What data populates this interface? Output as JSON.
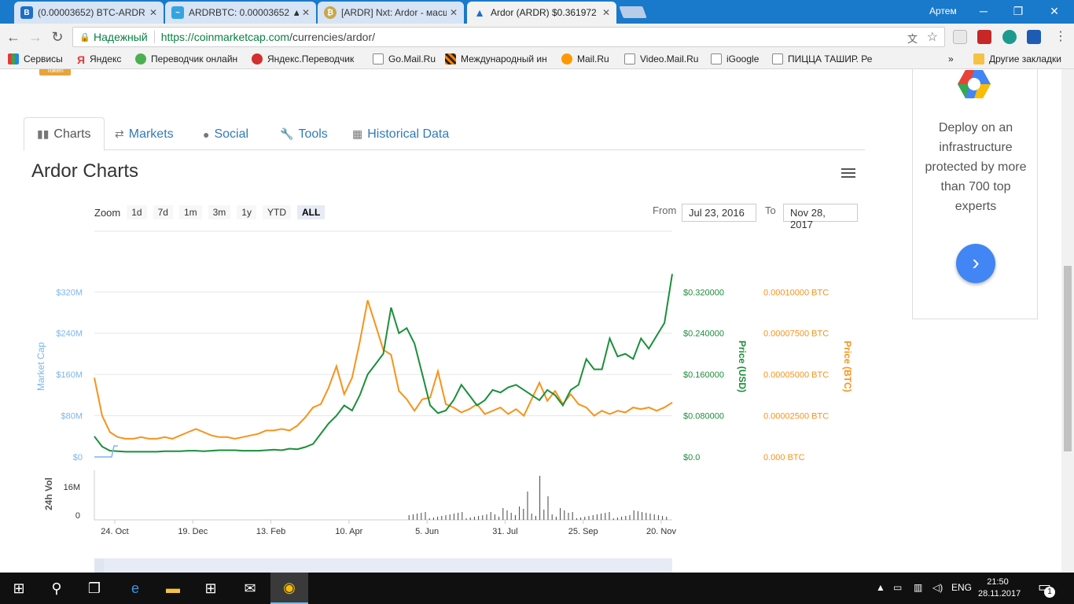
{
  "browser": {
    "tabs": [
      {
        "title": "(0.00003652) BTC-ARDR",
        "icon": "bittrex-icon",
        "color": "#1e6fc4"
      },
      {
        "title": "ARDRBTC: 0.00003652 ▲",
        "icon": "tradingview-icon",
        "color": "#36a3e0"
      },
      {
        "title": "[ARDR] Nxt: Ardor - масш",
        "icon": "bitcointalk-icon",
        "color": "#c9a74a"
      },
      {
        "title": "Ardor (ARDR) $0.361972",
        "icon": "ardor-icon",
        "color": "#1e6fc4"
      }
    ],
    "user": "Артем",
    "secure_label": "Надежный",
    "url_domain": "https://coinmarketcap.com",
    "url_path": "/currencies/ardor/",
    "bookmarks": [
      "Сервисы",
      "Яндекс",
      "Переводчик онлайн",
      "Яндекс.Переводчик",
      "Go.Mail.Ru",
      "Международный ин",
      "Mail.Ru",
      "Video.Mail.Ru",
      "iGoogle",
      "ПИЦЦА ТАШИР. Ре"
    ],
    "bookmarks_more": "»",
    "other_bookmarks": "Другие закладки"
  },
  "page": {
    "token_badge": "Token",
    "tabs": [
      "Charts",
      "Markets",
      "Social",
      "Tools",
      "Historical Data"
    ],
    "chart_title": "Ardor Charts",
    "zoom_label": "Zoom",
    "zoom_options": [
      "1d",
      "7d",
      "1m",
      "3m",
      "1y",
      "YTD",
      "ALL"
    ],
    "from_label": "From",
    "from_date": "Jul 23, 2016",
    "to_label": "To",
    "to_date": "Nov 28, 2017"
  },
  "chart_data": {
    "type": "line",
    "x_ticks": [
      "24. Oct",
      "19. Dec",
      "13. Feb",
      "10. Apr",
      "5. Jun",
      "31. Jul",
      "25. Sep",
      "20. Nov"
    ],
    "market_cap_axis": {
      "label": "Market Cap",
      "ticks": [
        "$0",
        "$80M",
        "$160M",
        "$240M",
        "$320M"
      ],
      "color": "#7cb5ec"
    },
    "usd_axis": {
      "label": "Price (USD)",
      "ticks": [
        "$0.0",
        "$0.080000",
        "$0.160000",
        "$0.240000",
        "$0.320000"
      ],
      "color": "#1a8f3a",
      "ylim": [
        0,
        0.32
      ]
    },
    "btc_axis": {
      "label": "Price (BTC)",
      "ticks": [
        "0.000 BTC",
        "0.00002500 BTC",
        "0.00005000 BTC",
        "0.00007500 BTC",
        "0.00010000 BTC"
      ],
      "color": "#f7931a",
      "ylim": [
        0,
        0.0001
      ]
    },
    "volume_axis": {
      "label": "24h Vol",
      "ticks": [
        "0",
        "16M"
      ]
    },
    "series": [
      {
        "name": "Price (USD)",
        "color": "#1a8f3a",
        "values": [
          0.04,
          0.02,
          0.012,
          0.011,
          0.01,
          0.01,
          0.01,
          0.01,
          0.01,
          0.011,
          0.011,
          0.011,
          0.012,
          0.012,
          0.011,
          0.012,
          0.013,
          0.013,
          0.013,
          0.012,
          0.012,
          0.012,
          0.013,
          0.014,
          0.013,
          0.016,
          0.015,
          0.019,
          0.025,
          0.045,
          0.065,
          0.08,
          0.1,
          0.09,
          0.12,
          0.16,
          0.18,
          0.2,
          0.29,
          0.24,
          0.25,
          0.22,
          0.16,
          0.1,
          0.085,
          0.09,
          0.11,
          0.14,
          0.12,
          0.1,
          0.11,
          0.13,
          0.125,
          0.135,
          0.14,
          0.13,
          0.12,
          0.11,
          0.13,
          0.12,
          0.1,
          0.13,
          0.14,
          0.19,
          0.17,
          0.17,
          0.23,
          0.195,
          0.2,
          0.19,
          0.23,
          0.21,
          0.235,
          0.26,
          0.355
        ]
      },
      {
        "name": "Price (BTC)",
        "color": "#f7931a",
        "values": [
          4.8e-05,
          2.5e-05,
          1.5e-05,
          1.2e-05,
          1.1e-05,
          1.1e-05,
          1.2e-05,
          1.1e-05,
          1.1e-05,
          1.2e-05,
          1.1e-05,
          1.3e-05,
          1.5e-05,
          1.7e-05,
          1.5e-05,
          1.3e-05,
          1.2e-05,
          1.2e-05,
          1.1e-05,
          1.2e-05,
          1.3e-05,
          1.4e-05,
          1.6e-05,
          1.6e-05,
          1.7e-05,
          1.6e-05,
          1.9e-05,
          2.4e-05,
          3e-05,
          3.2e-05,
          4.2e-05,
          5.5e-05,
          3.8e-05,
          4.8e-05,
          7e-05,
          9.5e-05,
          8e-05,
          6.5e-05,
          6.2e-05,
          4e-05,
          3.5e-05,
          2.8e-05,
          3.5e-05,
          3.6e-05,
          5.2e-05,
          3.2e-05,
          3e-05,
          2.7e-05,
          2.9e-05,
          3.2e-05,
          2.6e-05,
          2.8e-05,
          3e-05,
          2.6e-05,
          2.9e-05,
          2.5e-05,
          3.5e-05,
          4.5e-05,
          3.4e-05,
          4e-05,
          3.2e-05,
          3.8e-05,
          3.2e-05,
          3e-05,
          2.5e-05,
          2.8e-05,
          2.6e-05,
          2.8e-05,
          2.7e-05,
          3e-05,
          2.9e-05,
          3e-05,
          2.8e-05,
          3e-05,
          3.3e-05
        ]
      },
      {
        "name": "Market Cap",
        "color": "#7cb5ec",
        "values": [
          0,
          0,
          0,
          14
        ]
      }
    ]
  },
  "ad": {
    "text": "Deploy on an infrastructure protected by more than 700 top experts",
    "button_icon": "chevron-right-icon"
  },
  "taskbar": {
    "language": "ENG",
    "time": "21:50",
    "date": "28.11.2017",
    "notification_count": "1"
  }
}
